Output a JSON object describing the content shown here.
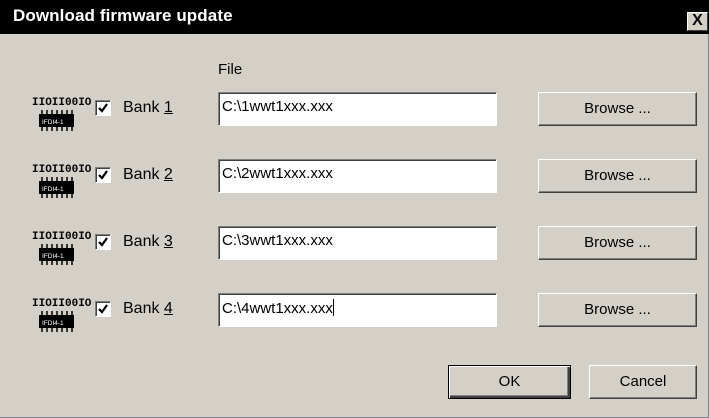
{
  "window": {
    "title": "Download firmware update",
    "close_label": "X"
  },
  "file_column_header": "File",
  "banks": [
    {
      "prefix": "Bank ",
      "number": "1",
      "checked": true,
      "path": "C:\\1wwt1xxx.xxx",
      "browse_label": "Browse ...",
      "icon": "firmware-chip-icon"
    },
    {
      "prefix": "Bank ",
      "number": "2",
      "checked": true,
      "path": "C:\\2wwt1xxx.xxx",
      "browse_label": "Browse ...",
      "icon": "firmware-chip-icon"
    },
    {
      "prefix": "Bank ",
      "number": "3",
      "checked": true,
      "path": "C:\\3wwt1xxx.xxx",
      "browse_label": "Browse ...",
      "icon": "firmware-chip-icon"
    },
    {
      "prefix": "Bank ",
      "number": "4",
      "checked": true,
      "path": "C:\\4wwt1xxx.xxx",
      "browse_label": "Browse ...",
      "icon": "firmware-chip-icon"
    }
  ],
  "buttons": {
    "ok_label": "OK",
    "cancel_label": "Cancel"
  },
  "chip_binary": "IIOII00IOI",
  "chip_marking": "IFDI4-1",
  "colors": {
    "dialog_face": "#d4d0c8",
    "titlebar": "#000000",
    "title_text": "#ffffff"
  }
}
